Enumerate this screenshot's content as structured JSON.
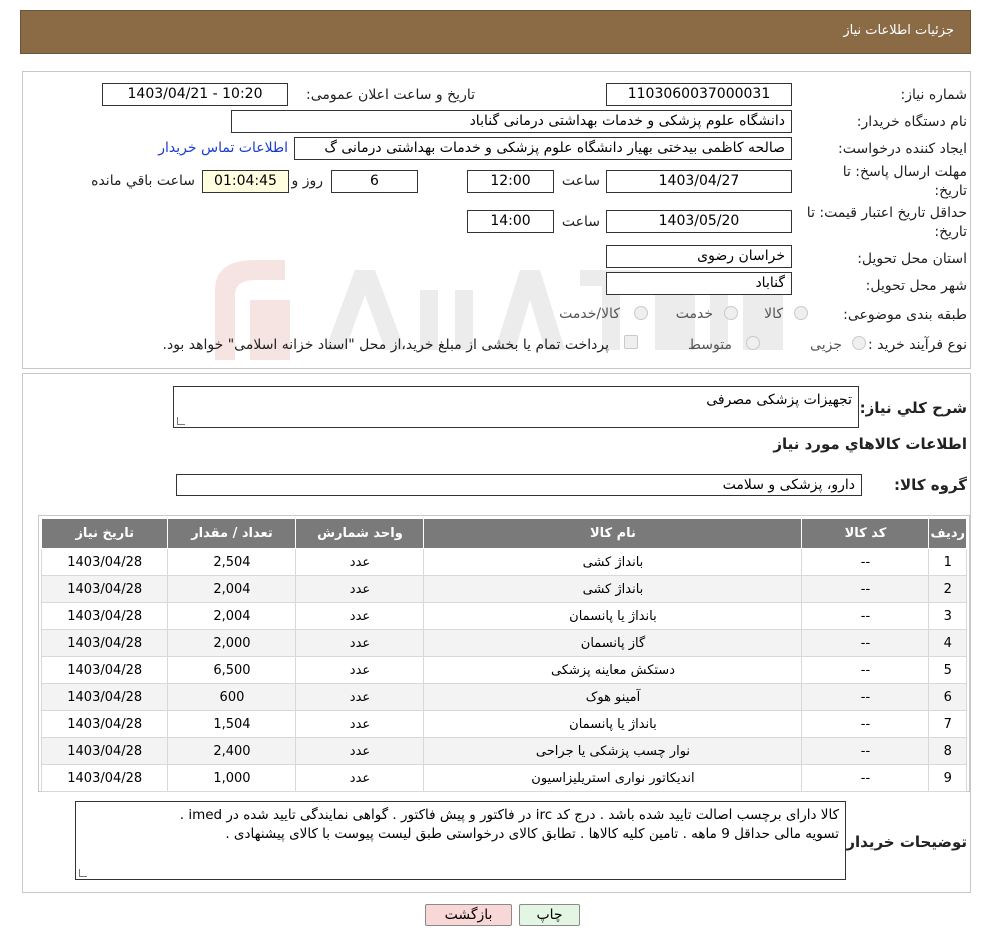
{
  "header": {
    "title": "جزئیات اطلاعات نیاز"
  },
  "fields": {
    "need_number_label": "شماره نیاز:",
    "need_number": "1103060037000031",
    "announce_label": "تاریخ و ساعت اعلان عمومی:",
    "announce_value": "1403/04/21 - 10:20",
    "buyer_org_label": "نام دستگاه خریدار:",
    "buyer_org": "دانشگاه علوم پزشکی و خدمات بهداشتی درمانی گناباد",
    "creator_label": "ایجاد کننده درخواست:",
    "creator": "صالحه کاظمی بیدختی بهیار دانشگاه علوم پزشکی و خدمات بهداشتی درمانی گ",
    "contact_link": "اطلاعات تماس خریدار",
    "deadline_label_1": "مهلت ارسال پاسخ: تا",
    "deadline_label_2": "تاریخ:",
    "deadline_date": "1403/04/27",
    "time_label": "ساعت",
    "deadline_time": "12:00",
    "days_value": "6",
    "days_label": "روز و",
    "remaining_time": "01:04:45",
    "remaining_label": "ساعت باقي مانده",
    "validity_label_1": "حداقل تاریخ اعتبار قیمت: تا",
    "validity_label_2": "تاریخ:",
    "validity_date": "1403/05/20",
    "validity_time": "14:00",
    "province_label": "استان محل تحویل:",
    "province": "خراسان رضوی",
    "city_label": "شهر محل تحویل:",
    "city": "گناباد",
    "category_label": "طبقه بندی موضوعی:",
    "category_options": [
      "کالا",
      "خدمت",
      "کالا/خدمت"
    ],
    "process_label": "نوع فرآیند خرید :",
    "process_options": [
      "جزیی",
      "متوسط"
    ],
    "payment_note": "پرداخت تمام یا بخشی از مبلغ خرید،از محل \"اسناد خزانه اسلامی\" خواهد بود."
  },
  "summary": {
    "desc_label": "شرح کلي نياز:",
    "desc_value": "تجهيزات پزشکی مصرفی",
    "items_heading": "اطلاعات کالاهاي مورد نياز",
    "group_label": "گروه کالا:",
    "group_value": "دارو، پزشکی و سلامت"
  },
  "table": {
    "headers": [
      "رديف",
      "کد کالا",
      "نام کالا",
      "واحد شمارش",
      "تعداد / مقدار",
      "تاریخ نیاز"
    ],
    "rows": [
      [
        "1",
        "--",
        "بانداژ کشی",
        "عدد",
        "2,504",
        "1403/04/28"
      ],
      [
        "2",
        "--",
        "باند‌اژ کشی",
        "عدد",
        "2,004",
        "1403/04/28"
      ],
      [
        "3",
        "--",
        "باند‌اژ یا پانسمان",
        "عدد",
        "2,004",
        "1403/04/28"
      ],
      [
        "4",
        "--",
        "گاز پانسمان",
        "عدد",
        "2,000",
        "1403/04/28"
      ],
      [
        "5",
        "--",
        "دستکش معاینه پزشکی",
        "عدد",
        "6,500",
        "1403/04/28"
      ],
      [
        "6",
        "--",
        "آمینو هوک",
        "عدد",
        "600",
        "1403/04/28"
      ],
      [
        "7",
        "--",
        "باند‌اژ یا پانسمان",
        "عدد",
        "1,504",
        "1403/04/28"
      ],
      [
        "8",
        "--",
        "نوار چسب پزشکی یا جراحی",
        "عدد",
        "2,400",
        "1403/04/28"
      ],
      [
        "9",
        "--",
        "اندیکاتور نواری استریلیزاسیون",
        "عدد",
        "1,000",
        "1403/04/28"
      ]
    ]
  },
  "notes": {
    "label": "توضیحات خریدار:",
    "line1": "کالا دارای برچسب اصالت تایید شده باشد . درج کد irc در فاکتور و پیش فاکتور . گواهی نمایندگی تایید شده در imed .",
    "line2": "تسویه مالی حداقل 9 ماهه . تامین کلیه کالاها . تطابق کالای درخواستی طبق لیست پیوست با کالای پیشنهادی ."
  },
  "buttons": {
    "print": "چاپ",
    "back": "بازگشت"
  },
  "colors": {
    "header_bg": "#8a6b45",
    "table_header_bg": "#7a7a7a",
    "back_button_bg": "#f8d7d7",
    "print_button_bg": "#e3f6e3"
  }
}
